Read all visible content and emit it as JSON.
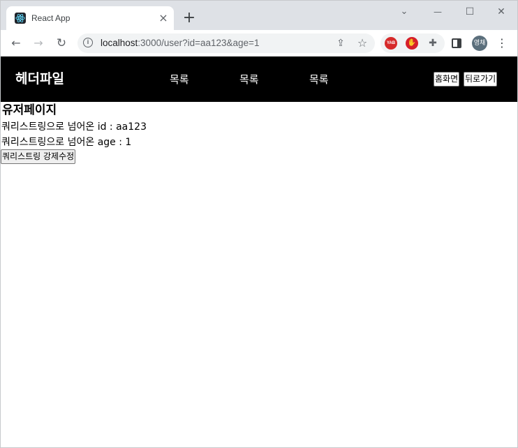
{
  "browser": {
    "tab": {
      "title": "React App",
      "close_glyph": "×",
      "favicon": "react-icon"
    },
    "new_tab_glyph": "+",
    "window_controls": {
      "dropdown": "⌄",
      "minimize": "—",
      "maximize": "☐",
      "close": "✕"
    },
    "toolbar": {
      "back": "←",
      "forward": "→",
      "reload": "↻",
      "url_host": "localhost",
      "url_rest": ":3000/user?id=aa123&age=1",
      "info_glyph": "i",
      "share_glyph": "⇪",
      "star_glyph": "☆",
      "extensions": {
        "yab_label": "YAB",
        "stop_glyph": "✋",
        "puzzle_glyph": "✚"
      },
      "avatar_label": "영채",
      "menu_glyph": "⋮"
    },
    "colors": {
      "tabstrip": "#dee1e6",
      "omnibox": "#f1f3f4",
      "header": "#000000"
    }
  },
  "app": {
    "header": {
      "logo": "헤더파일",
      "nav": [
        "목록",
        "목록",
        "목록"
      ],
      "home_button": "홈화면",
      "back_button": "뒤로가기"
    },
    "user_page": {
      "title": "유저페이지",
      "id_line": "쿼리스트링으로 넘어온 id : aa123",
      "age_line": "쿼리스트링으로 넘어온 age : 1",
      "force_button": "쿼리스트링 강제수정"
    }
  }
}
